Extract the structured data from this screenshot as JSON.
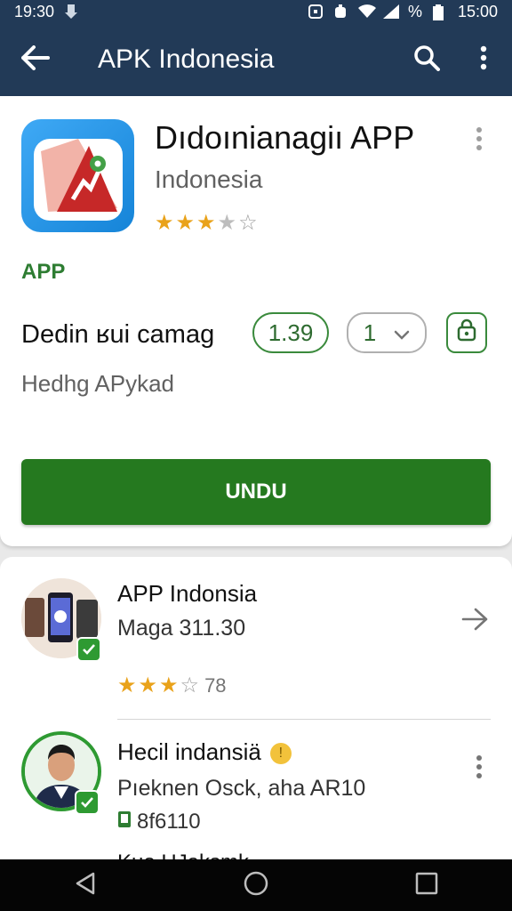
{
  "status_bar": {
    "time": "19:30",
    "right_time": "15:00",
    "battery_text": "%",
    "icons": [
      "download-icon",
      "qr-icon",
      "shield-icon",
      "wifi-icon",
      "signal-icon",
      "battery-icon"
    ]
  },
  "app_bar": {
    "title": "APK Indonesia",
    "icons": [
      "back-arrow-icon",
      "search-icon",
      "more-vert-icon"
    ]
  },
  "app_detail": {
    "name": "Dıdoınianagiı APP",
    "developer": "Indonesia",
    "rating_stars": 3.5,
    "tag": "APP",
    "info_label": "Dedin ʁui camag",
    "version": "1.39",
    "quantity": "1",
    "sub_label": "Hedhg APykad",
    "download_label": "UNDU",
    "icon_colors": {
      "bg": "#2196f3",
      "accent": "#d32f2f",
      "pin": "#43a047"
    }
  },
  "list": {
    "items": [
      {
        "title": "APP Indonsia",
        "subtitle": "Maga 311.30",
        "rating_stars": 3,
        "rating_count": "78"
      },
      {
        "title": "Hecil indansiä",
        "subtitle": "Pıeknen Osck, aha AR10",
        "meta": "8f6110",
        "peek": "Kuo HJaksmk..."
      }
    ]
  },
  "nav_bar": {
    "icons": [
      "nav-back-icon",
      "nav-home-icon",
      "nav-recents-icon"
    ]
  },
  "colors": {
    "primary": "#223a57",
    "accent_green": "#25791f",
    "star": "#e9a21a"
  }
}
